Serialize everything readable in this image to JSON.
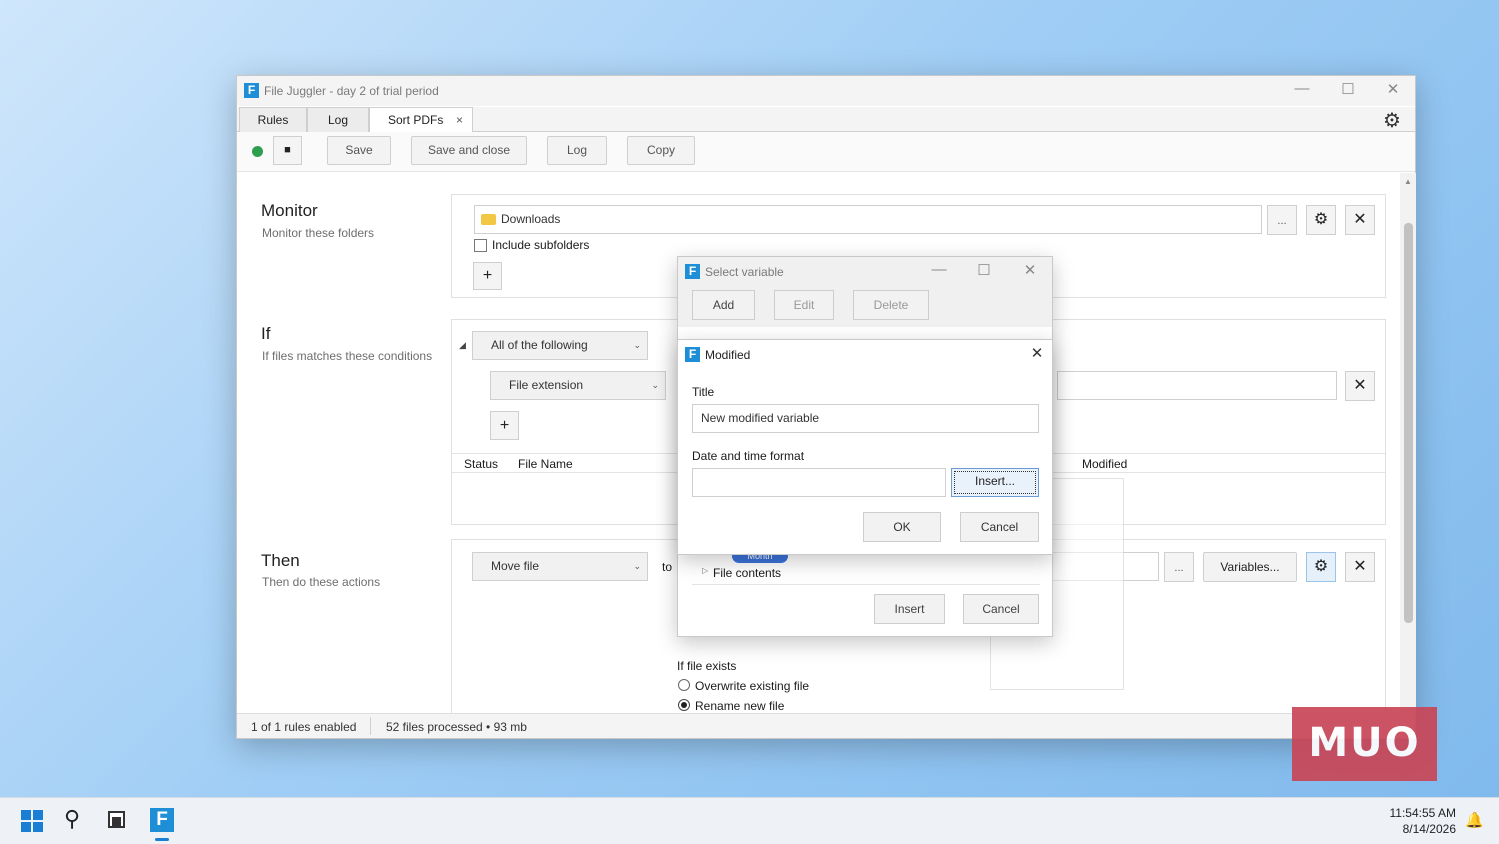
{
  "window": {
    "title": "File Juggler - day 2 of trial period",
    "tabs": [
      {
        "label": "Rules"
      },
      {
        "label": "Log"
      },
      {
        "label": "Sort PDFs",
        "close": "×"
      }
    ],
    "toolbar": {
      "save": "Save",
      "save_close": "Save and close",
      "log": "Log",
      "copy": "Copy"
    }
  },
  "monitor": {
    "title": "Monitor",
    "subtitle": "Monitor these folders",
    "folder": "Downloads",
    "browse": "...",
    "include_subfolders": "Include subfolders"
  },
  "if_section": {
    "title": "If",
    "subtitle": "If files matches these conditions",
    "match_mode": "All of the following",
    "condition_type": "File extension",
    "columns": {
      "status": "Status",
      "file_name": "File Name",
      "modified": "Modified"
    }
  },
  "then_section": {
    "title": "Then",
    "subtitle": "Then do these actions",
    "action": "Move file",
    "to": "to",
    "browse": "...",
    "variables": "Variables...",
    "if_file_exists": "If file exists",
    "overwrite": "Overwrite existing file",
    "rename": "Rename new file"
  },
  "status_bar": {
    "rules": "1 of 1 rules enabled",
    "files": "52 files processed • 93 mb"
  },
  "select_variable_dialog": {
    "title": "Select variable",
    "add": "Add",
    "edit": "Edit",
    "delete": "Delete",
    "tag": "Month",
    "tree_item": "File contents",
    "insert": "Insert",
    "cancel": "Cancel"
  },
  "modified_dialog": {
    "title": "Modified",
    "title_label": "Title",
    "title_value": "New modified variable",
    "format_label": "Date and time format",
    "format_value": "",
    "insert": "Insert...",
    "ok": "OK",
    "cancel": "Cancel"
  },
  "taskbar": {
    "time": "11:54:55 AM",
    "date": "8/14/2026"
  },
  "watermark": "MUO",
  "colors": {
    "accent": "#1e8fd6",
    "status_dot": "#2e9e4f",
    "watermark": "#c94657"
  }
}
